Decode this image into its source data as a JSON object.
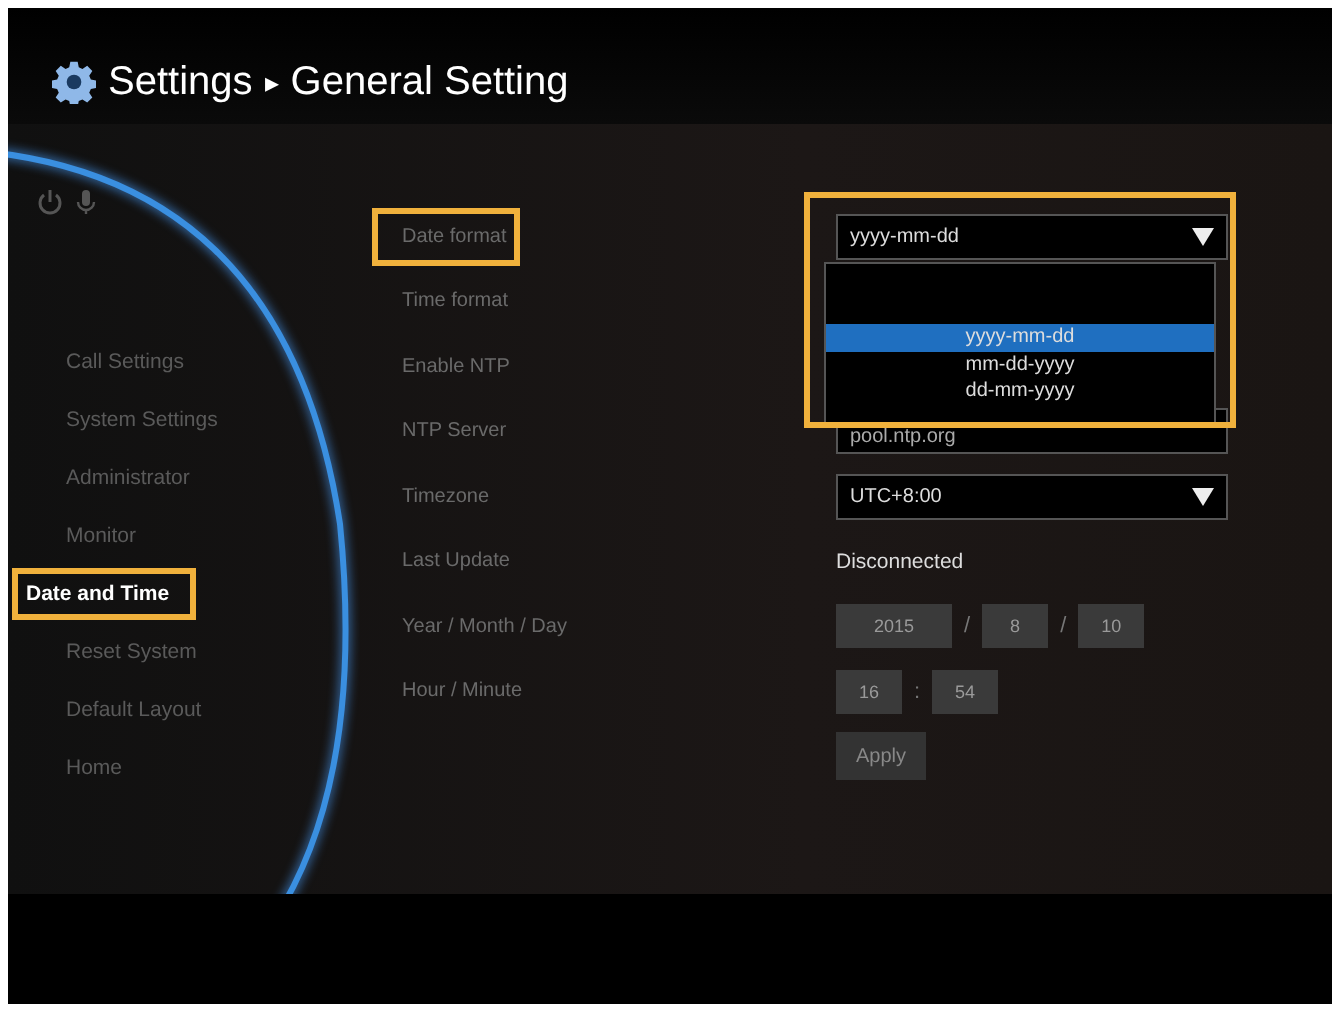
{
  "header": {
    "title": "Settings",
    "separator": "▸",
    "subtitle": "General Setting"
  },
  "sidebar": {
    "items": [
      {
        "label": "Call Settings",
        "selected": false
      },
      {
        "label": "System Settings",
        "selected": false
      },
      {
        "label": "Administrator",
        "selected": false
      },
      {
        "label": "Monitor",
        "selected": false
      },
      {
        "label": "Date and Time",
        "selected": true
      },
      {
        "label": "Reset System",
        "selected": false
      },
      {
        "label": "Default Layout",
        "selected": false
      },
      {
        "label": "Home",
        "selected": false
      }
    ]
  },
  "form": {
    "rows": [
      {
        "label": "Date format",
        "highlighted": true
      },
      {
        "label": "Time format",
        "highlighted": false
      },
      {
        "label": "Enable NTP",
        "highlighted": false
      },
      {
        "label": "NTP Server",
        "highlighted": false
      },
      {
        "label": "Timezone",
        "highlighted": false
      },
      {
        "label": "Last Update",
        "highlighted": false
      },
      {
        "label": "Year / Month / Day",
        "highlighted": false
      },
      {
        "label": "Hour / Minute",
        "highlighted": false
      }
    ]
  },
  "date_format": {
    "value": "yyyy-mm-dd",
    "expanded": true,
    "highlighted": true,
    "options": [
      {
        "label": "yyyy-mm-dd",
        "selected": true
      },
      {
        "label": "mm-dd-yyyy",
        "selected": false
      },
      {
        "label": "dd-mm-yyyy",
        "selected": false
      }
    ]
  },
  "ntp_server": {
    "value": "pool.ntp.org"
  },
  "timezone": {
    "value": "UTC+8:00"
  },
  "last_update": "Disconnected",
  "date": {
    "year": "2015",
    "month": "8",
    "day": "10",
    "separator": "/"
  },
  "time": {
    "hour": "16",
    "minute": "54",
    "separator": ":"
  },
  "apply": "Apply"
}
